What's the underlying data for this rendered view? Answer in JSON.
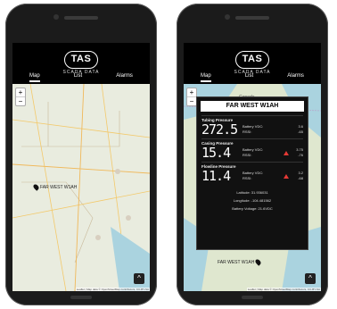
{
  "left_phone": {
    "logo": {
      "name": "TAS",
      "subtitle": "SCADA DATA"
    },
    "tabs": [
      {
        "label": "Map",
        "active": true
      },
      {
        "label": "List",
        "active": false
      },
      {
        "label": "Alarms",
        "active": false
      }
    ],
    "map": {
      "zoom_in": "+",
      "zoom_out": "−",
      "pin_label": "FAR WEST W1AH",
      "attribution": "Leaflet | Map data © OpenStreetMap contributors, CC-BY-SA",
      "up_button": "^"
    }
  },
  "right_phone": {
    "logo": {
      "name": "TAS",
      "subtitle": "SCADA DATA"
    },
    "tabs": [
      {
        "label": "Map",
        "active": true
      },
      {
        "label": "List",
        "active": false
      },
      {
        "label": "Alarms",
        "active": false
      }
    ],
    "map": {
      "zoom_in": "+",
      "zoom_out": "−",
      "region_label": "Canada",
      "pin_label": "FAR WEST W1AH",
      "attribution": "Leaflet | Map data © OpenStreetMap contributors, CC-BY-SA",
      "up_button": "^"
    },
    "popup": {
      "title": "FAR WEST W1AH",
      "sections": [
        {
          "title": "Tubing Pressure",
          "value": "272.5",
          "battery_label": "Battery VDC:",
          "battery_value": "3.6",
          "rssi_label": "RSSI:",
          "rssi_value": "-65",
          "alarm": false
        },
        {
          "title": "Casing Pressure",
          "value": "15.4",
          "battery_label": "Battery VDC:",
          "battery_value": "3.75",
          "rssi_label": "RSSI:",
          "rssi_value": "-76",
          "alarm": true
        },
        {
          "title": "Flowline Pressure",
          "value": "11.4",
          "battery_label": "Battery VDC:",
          "battery_value": "3.2",
          "rssi_label": "RSSI:",
          "rssi_value": "-68",
          "alarm": true
        }
      ],
      "latitude": "Latitude: 31.936031",
      "longitude": "Longitude: -104.481562",
      "battery_voltage": "Battery Voltage: 21.6VDC"
    }
  },
  "colors": {
    "alarm": "#e53935",
    "header": "#000000",
    "map": "#e9ecdf"
  }
}
